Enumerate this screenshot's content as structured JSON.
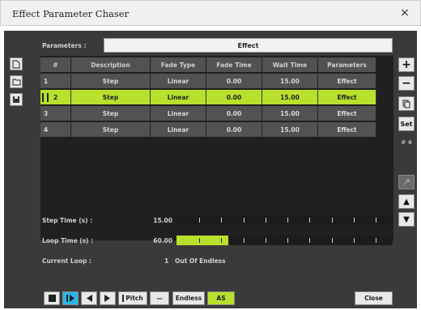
{
  "window": {
    "title": "Effect Parameter Chaser",
    "close_glyph": "×"
  },
  "parameters": {
    "label": "Parameters :",
    "value": "Effect"
  },
  "table": {
    "headers": [
      "#",
      "Description",
      "Fade Type",
      "Fade Time",
      "Wait Time",
      "Parameters"
    ],
    "rows": [
      [
        "1",
        "Step",
        "Linear",
        "0.00",
        "15.00",
        "Effect"
      ],
      [
        "2",
        "Step",
        "Linear",
        "0.00",
        "15.00",
        "Effect"
      ],
      [
        "3",
        "Step",
        "Linear",
        "0.00",
        "15.00",
        "Effect"
      ],
      [
        "4",
        "Step",
        "Linear",
        "0.00",
        "15.00",
        "Effect"
      ]
    ],
    "selected_row": 2
  },
  "right_toolbar": {
    "add": "+",
    "remove": "−",
    "set": "Set",
    "count": "# 4",
    "up": "▲",
    "down": "▼"
  },
  "step_time": {
    "label": "Step Time (s) :",
    "value": "15.00"
  },
  "loop_time": {
    "label": "Loop Time (s) :",
    "value": "60.00",
    "progress_fraction": 0.24
  },
  "current_loop": {
    "label": "Current Loop :",
    "value": "1",
    "suffix": "Out Of Endless"
  },
  "bottom": {
    "pitch": "Pitch",
    "dash": "—",
    "endless": "Endless",
    "as": "AS",
    "close": "Close"
  },
  "colors": {
    "accent": "#b8e02c",
    "play": "#29b6e8",
    "panel": "#3a3a3a"
  }
}
